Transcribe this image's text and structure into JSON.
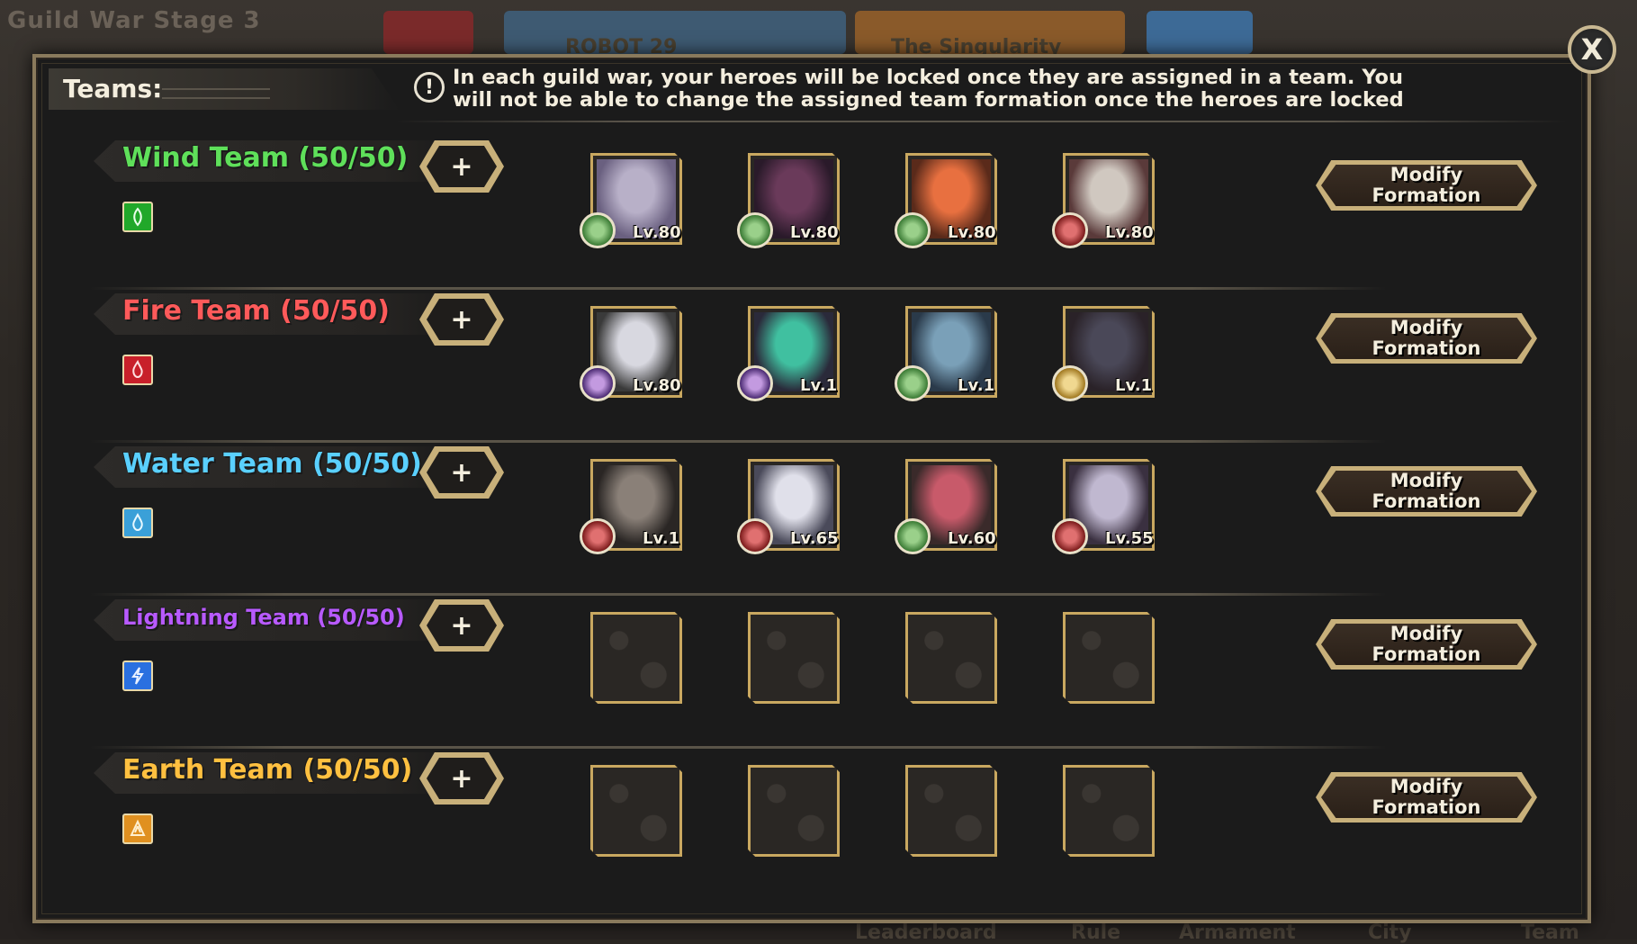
{
  "background": {
    "title": "Guild War Stage 3",
    "banner_left": "ROBOT 29",
    "banner_right": "The Singularity",
    "bottom_tabs": [
      "Leaderboard",
      "Rule",
      "Armament",
      "City",
      "Team"
    ]
  },
  "dialog": {
    "tab_label": "Teams:",
    "info_text": "In each guild war, your heroes will be locked once they are assigned in a team. You will not be able to change the assigned team formation once the heroes are locked",
    "close_label": "X",
    "add_label": "+",
    "modify_line1": "Modify",
    "modify_line2": "Formation"
  },
  "teams": [
    {
      "name": "Wind Team (50/50)",
      "color": "#5fe05a",
      "element_icon": "wind-icon",
      "element_color": "#21a82a",
      "heroes": [
        {
          "element": "wind",
          "level": "Lv.80"
        },
        {
          "element": "wind",
          "level": "Lv.80"
        },
        {
          "element": "wind",
          "level": "Lv.80"
        },
        {
          "element": "fire",
          "level": "Lv.80"
        }
      ]
    },
    {
      "name": "Fire Team (50/50)",
      "color": "#ff5a5a",
      "element_icon": "fire-icon",
      "element_color": "#c8202a",
      "heroes": [
        {
          "element": "dark",
          "level": "Lv.80"
        },
        {
          "element": "dark",
          "level": "Lv.1"
        },
        {
          "element": "wind",
          "level": "Lv.1"
        },
        {
          "element": "light",
          "level": "Lv.1"
        }
      ]
    },
    {
      "name": "Water Team (50/50)",
      "color": "#5ad0ff",
      "element_icon": "water-icon",
      "element_color": "#3aa0d8",
      "heroes": [
        {
          "element": "fire",
          "level": "Lv.1"
        },
        {
          "element": "fire",
          "level": "Lv.65"
        },
        {
          "element": "wind",
          "level": "Lv.60"
        },
        {
          "element": "fire",
          "level": "Lv.55"
        }
      ]
    },
    {
      "name": "Lightning Team (50/50)",
      "color": "#b85aff",
      "element_icon": "lightning-icon",
      "element_color": "#2a70e0",
      "heroes": []
    },
    {
      "name": "Earth Team (50/50)",
      "color": "#ffc040",
      "element_icon": "earth-icon",
      "element_color": "#e09020",
      "heroes": []
    }
  ]
}
